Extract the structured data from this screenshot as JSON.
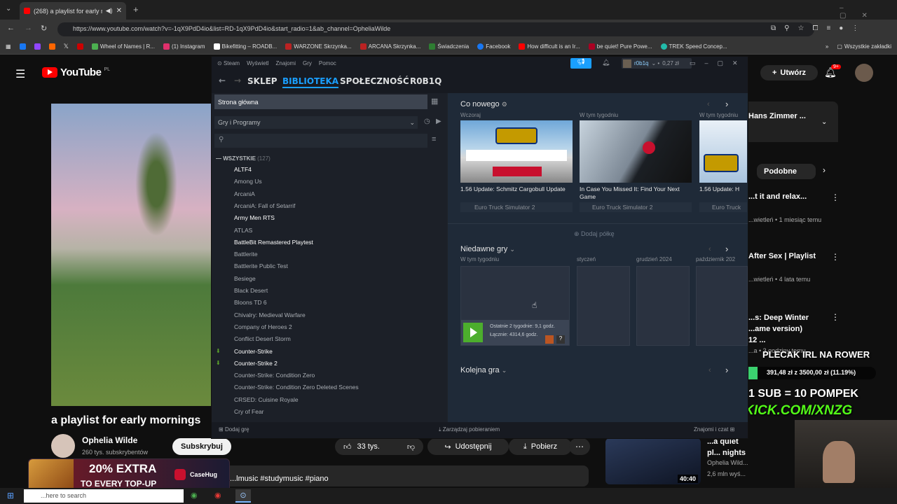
{
  "browser": {
    "tab_title": "(268) a playlist for early m",
    "url": "https://www.youtube.com/watch?v=-1qX9PdD4io&list=RD-1qX9PdD4io&start_radio=1&ab_channel=OpheliaWilde",
    "bookmarks": [
      "",
      "",
      "",
      "",
      "",
      "Wheel of Names | R...",
      "(1) Instagram",
      "Bikefitting – ROADB...",
      "WARZONE Skrzynka...",
      "ARCANA Skrzynka...",
      "Świadczenia",
      "Facebook",
      "How difficult is an Ir...",
      "be quiet! Pure Powe...",
      "TREK Speed Concep..."
    ],
    "all_bookmarks": "Wszystkie zakładki"
  },
  "youtube": {
    "logo": "YouTube",
    "region": "PL",
    "create": "Utwórz",
    "notif_count": "9+",
    "video_title": "a playlist for early mornings",
    "channel": "Ophelia Wilde",
    "subs": "260 tys. subskrybentów",
    "subscribe": "Subskrybuj",
    "likes": "33 tys.",
    "share": "Udostępnij",
    "download": "Pobierz",
    "hashtags": "...lmusic #studymusic #piano",
    "playlist_head": "Hans Zimmer ...",
    "similar": "Podobne",
    "side": [
      {
        "title": "...t it and relax...",
        "meta": "...wietleń • 1 miesiąc temu"
      },
      {
        "title": "After Sex | Playlist",
        "meta": "...wietleń • 4 lata temu"
      },
      {
        "title": "...s: Deep Winter ...ame version) 12 ...",
        "meta": "...a • 3 godziny temu"
      }
    ],
    "rec": {
      "title": "...a quiet pl... nights (re...",
      "channel": "Ophelia Wild...",
      "meta": "2,6 mln wyś...",
      "duration": "40:40"
    }
  },
  "overlay": {
    "title": "PLECAK IRL NA ROWER",
    "progress": "391,48 zł z 3500,00 zł (11.19%)",
    "progress_fraction": 0.1119,
    "sub_line": "1 SUB = 10 POMPEK",
    "kick": "KICK.COM/XNZG",
    "ad_text1": "20% EXTRA",
    "ad_text2": "TO EVERY TOP-UP",
    "ad_brand": "CaseHug"
  },
  "steam": {
    "menu": [
      "Steam",
      "Wyświetl",
      "Znajomi",
      "Gry",
      "Pomoc"
    ],
    "user": "r0b1q",
    "balance": "0,27 zł",
    "nav": [
      "SKLEP",
      "BIBLIOTEKA",
      "SPOŁECZNOŚĆ",
      "R0B1Q"
    ],
    "home": "Strona główna",
    "filter": "Gry i Programy",
    "all_label": "WSZYSTKIE",
    "all_count": "(127)",
    "games": [
      {
        "name": "ALTF4",
        "on": true
      },
      {
        "name": "Among Us",
        "on": false
      },
      {
        "name": "ArcaniA",
        "on": false
      },
      {
        "name": "ArcaniA: Fall of Setarrif",
        "on": false
      },
      {
        "name": "Army Men RTS",
        "on": true
      },
      {
        "name": "ATLAS",
        "on": false
      },
      {
        "name": "BattleBit Remastered Playtest",
        "on": true
      },
      {
        "name": "Battlerite",
        "on": false
      },
      {
        "name": "Battlerite Public Test",
        "on": false
      },
      {
        "name": "Besiege",
        "on": false
      },
      {
        "name": "Black Desert",
        "on": false
      },
      {
        "name": "Bloons TD 6",
        "on": false
      },
      {
        "name": "Chivalry: Medieval Warfare",
        "on": false
      },
      {
        "name": "Company of Heroes 2",
        "on": false
      },
      {
        "name": "Conflict Desert Storm",
        "on": false
      },
      {
        "name": "Counter-Strike",
        "on": true
      },
      {
        "name": "Counter-Strike 2",
        "on": true
      },
      {
        "name": "Counter-Strike: Condition Zero",
        "on": false
      },
      {
        "name": "Counter-Strike: Condition Zero Deleted Scenes",
        "on": false
      },
      {
        "name": "CRSED: Cuisine Royale",
        "on": false
      },
      {
        "name": "Cry of Fear",
        "on": false
      }
    ],
    "whats_new": "Co nowego",
    "news": [
      {
        "when": "Wczoraj",
        "title": "1.56 Update: Schmitz Cargobull Update",
        "game": "Euro Truck Simulator 2"
      },
      {
        "when": "W tym tygodniu",
        "title": "In Case You Missed It: Find Your Next Game",
        "game": "Euro Truck Simulator 2"
      },
      {
        "when": "W tym tygodniu",
        "title": "1.56 Update: H",
        "game": "Euro Truck"
      }
    ],
    "add_shelf": "Dodaj półkę",
    "recent": "Niedawne gry",
    "recent_cols": [
      "W tym tygodniu",
      "styczeń",
      "grudzień 2024",
      "październik 202"
    ],
    "last_two_weeks": "Ostatnie 2 tygodnie: 9,1 godz.",
    "total": "Łącznie: 4314,6 godz.",
    "next_game": "Kolejna gra",
    "add_game": "Dodaj grę",
    "manage_downloads": "Zarządzaj pobieraniem",
    "friends_chat": "Znajomi i czat"
  },
  "taskbar": {
    "search": "...here to search"
  }
}
